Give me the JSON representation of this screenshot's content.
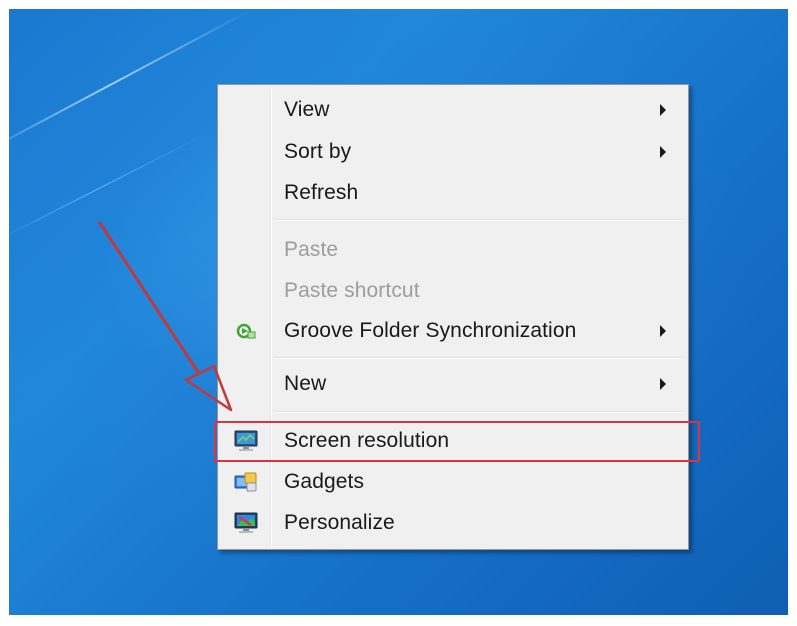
{
  "context_menu": {
    "items": [
      {
        "label": "View",
        "enabled": true,
        "submenu": true
      },
      {
        "label": "Sort by",
        "enabled": true,
        "submenu": true
      },
      {
        "label": "Refresh",
        "enabled": true,
        "submenu": false
      },
      {
        "label": "Paste",
        "enabled": false,
        "submenu": false
      },
      {
        "label": "Paste shortcut",
        "enabled": false,
        "submenu": false
      },
      {
        "label": "Groove Folder Synchronization",
        "enabled": true,
        "submenu": true,
        "icon": "groove-sync-icon"
      },
      {
        "label": "New",
        "enabled": true,
        "submenu": true
      },
      {
        "label": "Screen resolution",
        "enabled": true,
        "submenu": false,
        "icon": "screen-resolution-icon",
        "highlighted": true
      },
      {
        "label": "Gadgets",
        "enabled": true,
        "submenu": false,
        "icon": "gadgets-icon"
      },
      {
        "label": "Personalize",
        "enabled": true,
        "submenu": false,
        "icon": "personalize-icon"
      }
    ]
  },
  "annotations": {
    "highlight_color": "#d9343f",
    "arrow_color": "#c0393f",
    "highlighted_item": "Screen resolution"
  },
  "colors": {
    "desktop_blue": "#1a78d0",
    "menu_background": "#f0f0f0",
    "disabled_text": "#9d9d9d"
  }
}
